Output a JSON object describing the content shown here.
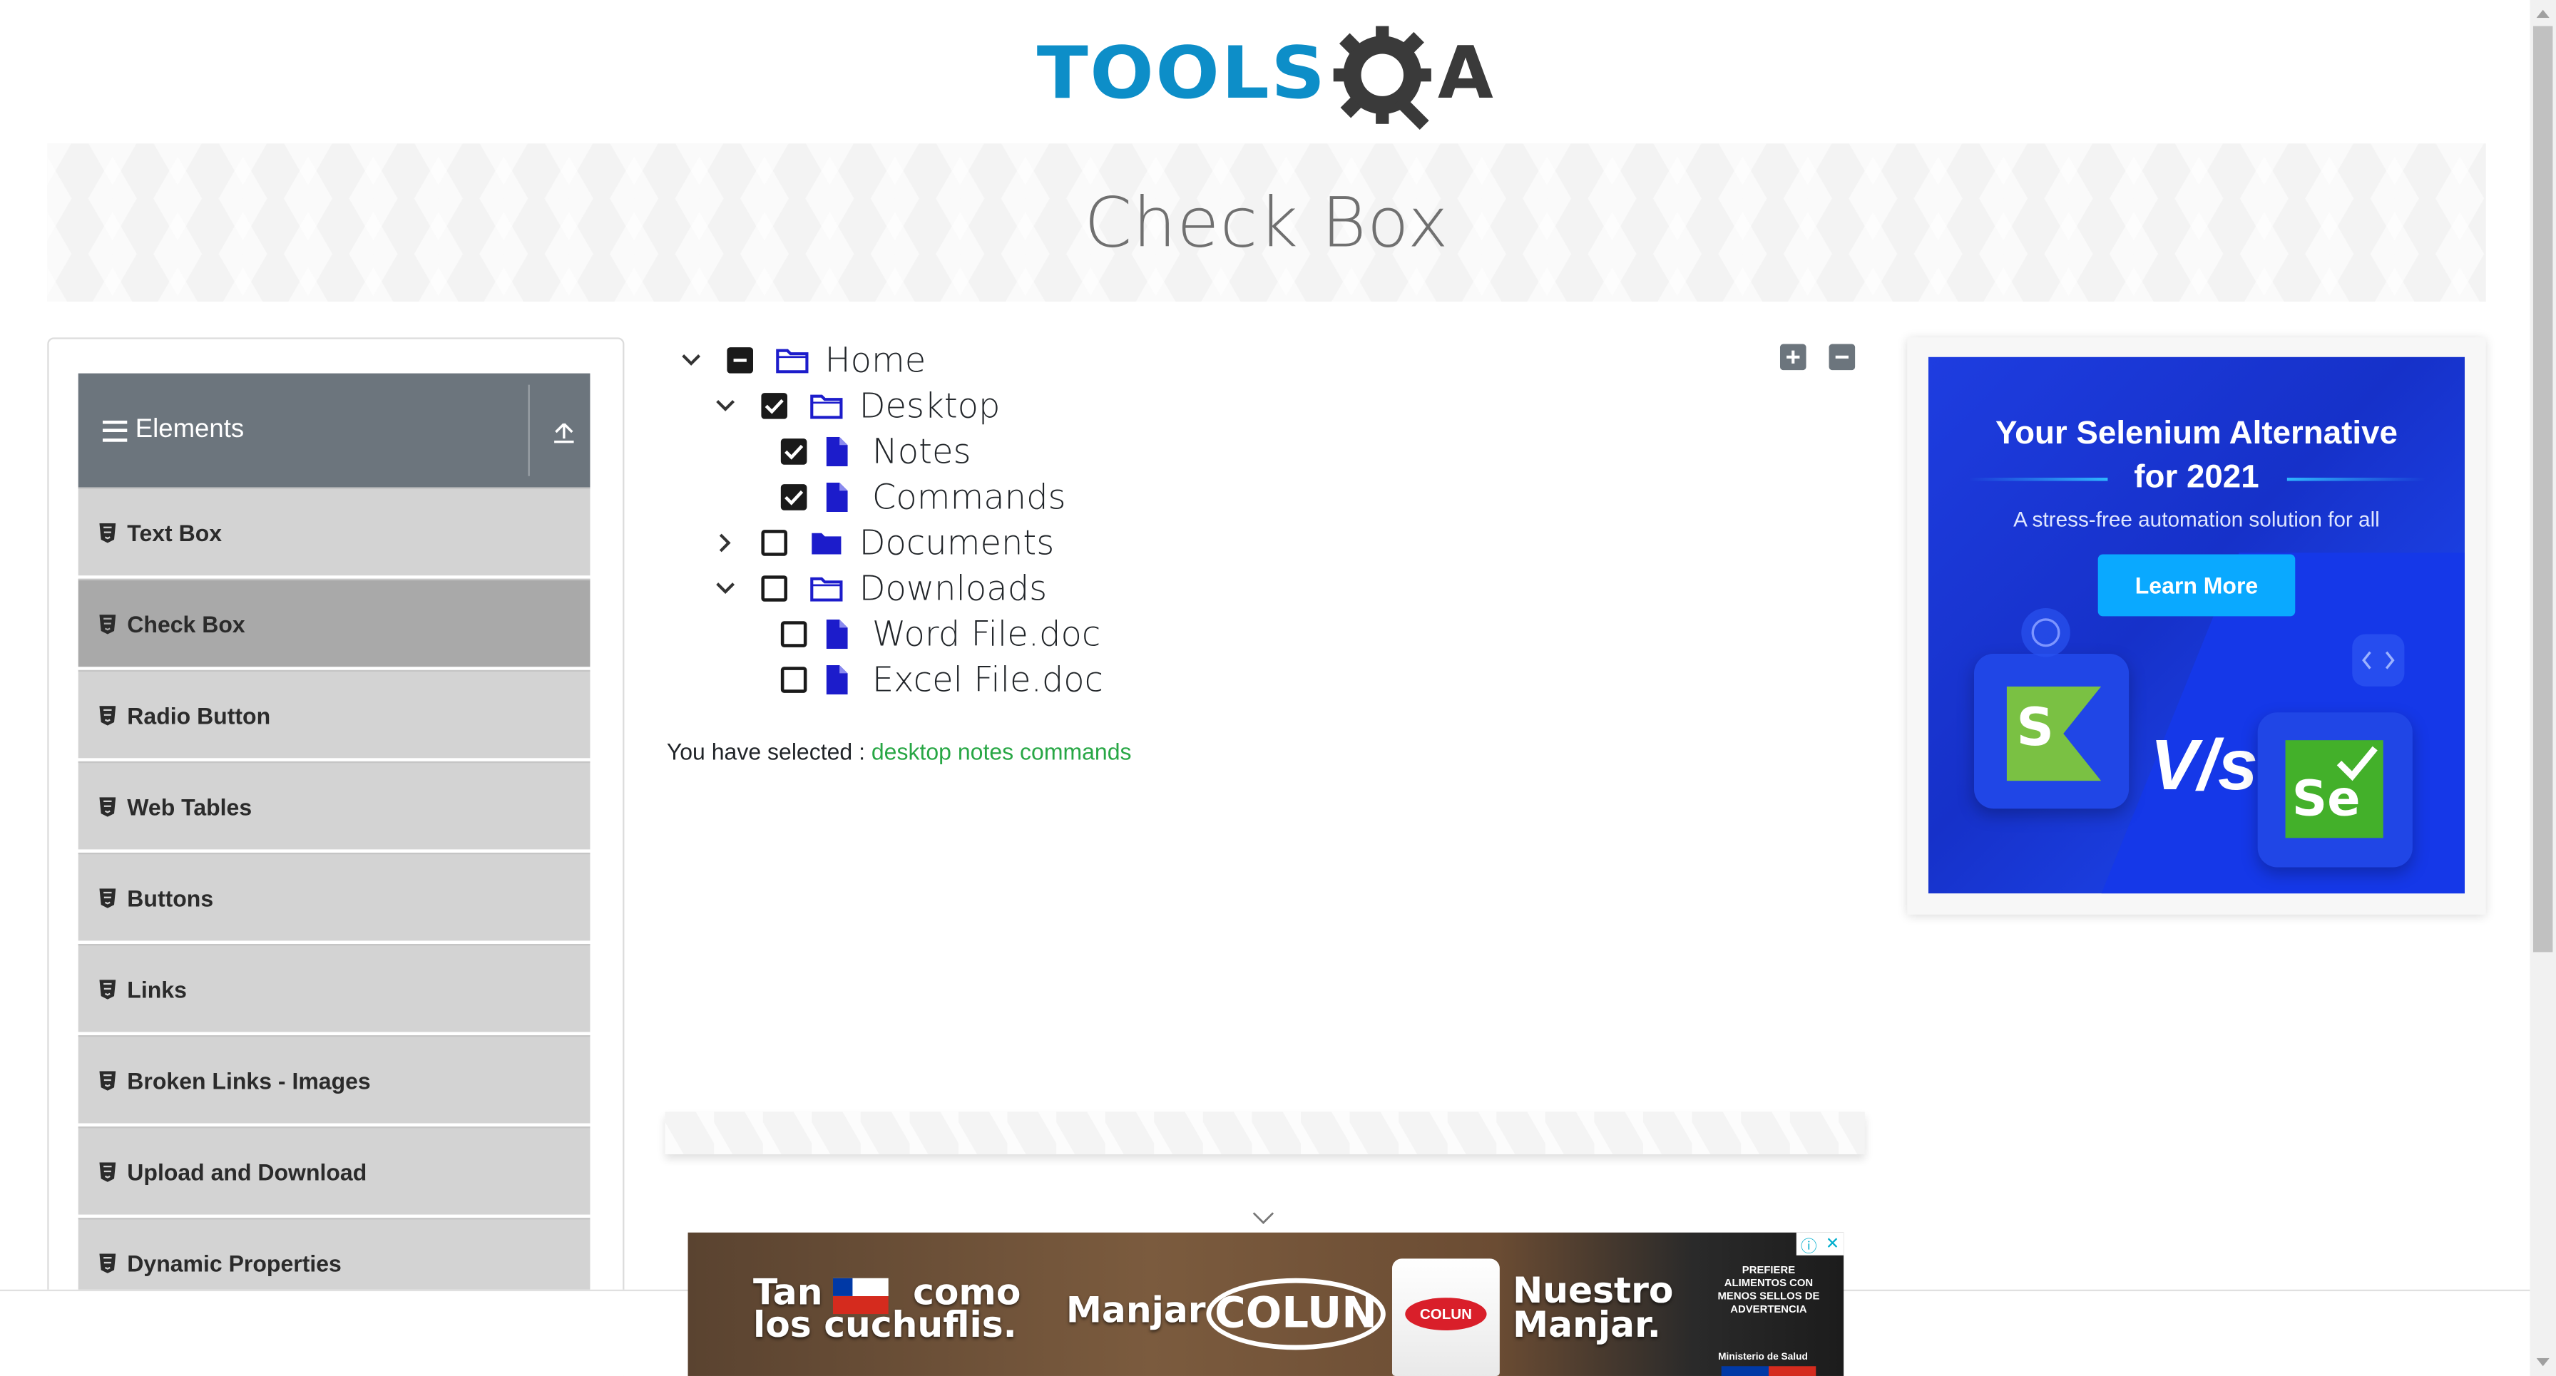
{
  "header": {
    "logo_text": "TOOLS",
    "logo_suffix": "A"
  },
  "banner": {
    "title": "Check Box"
  },
  "sidebar": {
    "group_title": "Elements",
    "items": [
      {
        "label": "Text Box"
      },
      {
        "label": "Check Box"
      },
      {
        "label": "Radio Button"
      },
      {
        "label": "Web Tables"
      },
      {
        "label": "Buttons"
      },
      {
        "label": "Links"
      },
      {
        "label": "Broken Links - Images"
      },
      {
        "label": "Upload and Download"
      },
      {
        "label": "Dynamic Properties"
      }
    ]
  },
  "tree": {
    "nodes": [
      {
        "label": "Home",
        "state": "half",
        "expanded": true
      },
      {
        "label": "Desktop",
        "state": "checked",
        "expanded": true
      },
      {
        "label": "Notes",
        "state": "checked"
      },
      {
        "label": "Commands",
        "state": "checked"
      },
      {
        "label": "Documents",
        "state": "unchecked",
        "expanded": false
      },
      {
        "label": "Downloads",
        "state": "unchecked",
        "expanded": true
      },
      {
        "label": "Word File.doc",
        "state": "unchecked"
      },
      {
        "label": "Excel File.doc",
        "state": "unchecked"
      }
    ],
    "expand_all_icon": "plus-square-icon",
    "collapse_all_icon": "minus-square-icon"
  },
  "result": {
    "prefix": "You have selected :",
    "items": "desktop notes commands"
  },
  "side_ad": {
    "title_line1": "Your Selenium Alternative",
    "title_line2": "for 2021",
    "subtitle": "A stress-free automation solution for all",
    "button_label": "Learn More",
    "vs_text": "V/s",
    "logo_left": "S",
    "logo_right": "Se"
  },
  "bottom_ad": {
    "line1": "Tan",
    "line1b": "como",
    "line2": "los cuchuflis.",
    "word_manjar": "Manjar",
    "brand": "COLUN",
    "cup_label": "COLUN",
    "slogan_line1": "Nuestro",
    "slogan_line2": "Manjar.",
    "warning": "PREFIERE ALIMENTOS CON MENOS SELLOS DE ADVERTENCIA",
    "ministry": "Ministerio de Salud"
  },
  "colors": {
    "brand_blue": "#0d8ec8",
    "sidebar_header": "#6c757d",
    "sidebar_item": "#d3d3d3",
    "sidebar_active": "#a9a9a9",
    "selected_text": "#28a745",
    "folder_icon": "#1c1ccb"
  }
}
